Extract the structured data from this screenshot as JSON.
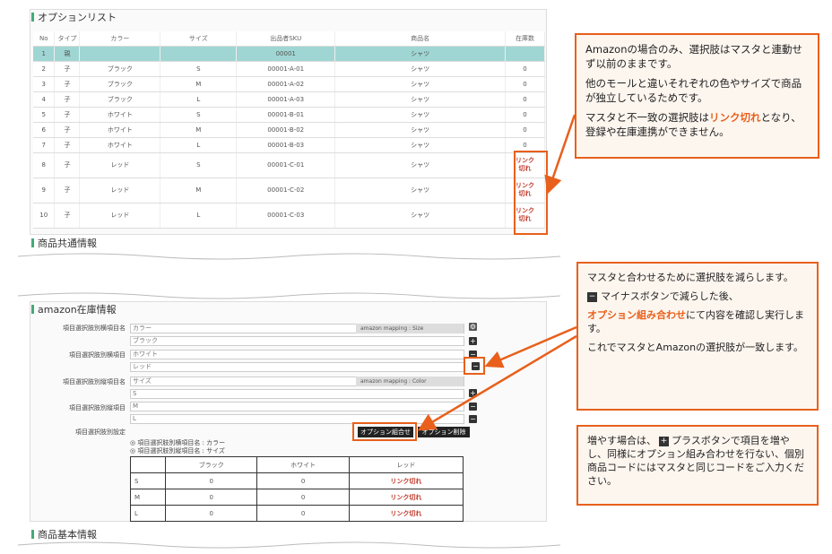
{
  "sections": {
    "option_list": "オプションリスト",
    "common_info": "商品共通情報",
    "amazon_stock": "amazon在庫情報",
    "basic_info": "商品基本情報"
  },
  "option_table": {
    "headers": [
      "No",
      "タイプ",
      "カラー",
      "サイズ",
      "出品者SKU",
      "商品名",
      "在庫数"
    ],
    "rows": [
      [
        "1",
        "親",
        "",
        "",
        "00001",
        "シャツ",
        ""
      ],
      [
        "2",
        "子",
        "ブラック",
        "S",
        "00001-A-01",
        "シャツ",
        "0"
      ],
      [
        "3",
        "子",
        "ブラック",
        "M",
        "00001-A-02",
        "シャツ",
        "0"
      ],
      [
        "4",
        "子",
        "ブラック",
        "L",
        "00001-A-03",
        "シャツ",
        "0"
      ],
      [
        "5",
        "子",
        "ホワイト",
        "S",
        "00001-B-01",
        "シャツ",
        "0"
      ],
      [
        "6",
        "子",
        "ホワイト",
        "M",
        "00001-B-02",
        "シャツ",
        "0"
      ],
      [
        "7",
        "子",
        "ホワイト",
        "L",
        "00001-B-03",
        "シャツ",
        "0"
      ],
      [
        "8",
        "子",
        "レッド",
        "S",
        "00001-C-01",
        "シャツ",
        "リンク切れ"
      ],
      [
        "9",
        "子",
        "レッド",
        "M",
        "00001-C-02",
        "シャツ",
        "リンク切れ"
      ],
      [
        "10",
        "子",
        "レッド",
        "L",
        "00001-C-03",
        "シャツ",
        "リンク切れ"
      ]
    ]
  },
  "form": {
    "label_horizontal": "項目選択肢別横項目名",
    "label_h_items": "項目選択肢別横項目",
    "label_vertical": "項目選択肢別縦項目名",
    "label_v_items": "項目選択肢別縦項目",
    "label_settings": "項目選択肢別設定",
    "color_field": "カラー",
    "h_item_1": "ブラック",
    "h_item_2": "ホワイト",
    "h_item_3": "レッド",
    "size_field": "サイズ",
    "v_item_1": "S",
    "v_item_2": "M",
    "v_item_3": "L",
    "mapping_size": "amazon mapping : Size",
    "mapping_color": "amazon mapping : Color",
    "btn_combine": "オプション組合せ",
    "btn_delete": "オプション削除",
    "note1": "◎ 項目選択肢別横項目名 : カラー",
    "note2": "◎ 項目選択肢別縦項目名 : サイズ"
  },
  "combo_table": {
    "headers": [
      "",
      "ブラック",
      "ホワイト",
      "レッド"
    ],
    "rows": [
      [
        "S",
        "0",
        "0",
        "リンク切れ"
      ],
      [
        "M",
        "0",
        "0",
        "リンク切れ"
      ],
      [
        "L",
        "0",
        "0",
        "リンク切れ"
      ]
    ]
  },
  "callouts": {
    "c1_p1": "Amazonの場合のみ、選択肢はマスタと連動せず以前のままです。",
    "c1_p2": "他のモールと違いそれぞれの色やサイズで商品が独立しているためです。",
    "c1_p3a": "マスタと不一致の選択肢は",
    "c1_p3b": "リンク切れ",
    "c1_p3c": "となり、登録や在庫連携ができません。",
    "c2_p1": "マスタと合わせるために選択肢を減らします。",
    "c2_p2": "マイナスボタンで減らした後、",
    "c2_p3a": "オプション組み合わせ",
    "c2_p3b": "にて内容を確認し実行します。",
    "c2_p4": "これでマスタとAmazonの選択肢が一致します。",
    "c3_a": "増やす場合は、",
    "c3_b": "プラスボタンで項目を増やし、同様にオプション組み合わせを行ない、個別商品コードにはマスタと同じコードをご入力ください。"
  },
  "colors": {
    "accent": "#e8601c",
    "highlight": "#9fd6d3",
    "link_broken": "#c0392b"
  }
}
